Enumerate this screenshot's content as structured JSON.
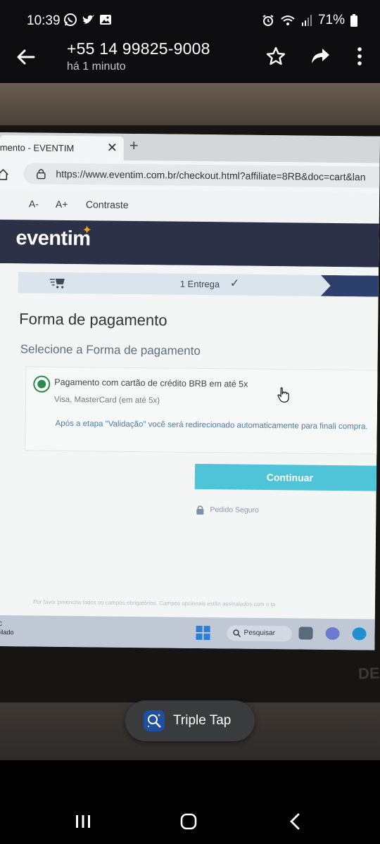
{
  "status_bar": {
    "time": "10:39",
    "battery": "71%",
    "notification_icons": [
      "whatsapp-icon",
      "twitter-icon",
      "gallery-icon"
    ],
    "system_icons": [
      "alarm-icon",
      "wifi-icon",
      "signal-icon",
      "battery-icon"
    ]
  },
  "header": {
    "title": "+55 14 99825-9008",
    "subtitle": "há 1 minuto"
  },
  "photo": {
    "browser": {
      "tab_title": "mento - EVENTIM",
      "tab_close": "✕",
      "new_tab": "+",
      "url": "https://www.eventim.com.br/checkout.html?affiliate=8RB&doc=cart&lan"
    },
    "accessibility_bar": {
      "decrease": "A-",
      "increase": "A+",
      "contrast": "Contraste"
    },
    "site": {
      "brand": "eventim",
      "brand_star": "✦",
      "step_label": "1  Entrega",
      "step_check": "✓",
      "heading": "Forma de pagamento",
      "subheading": "Selecione a Forma de pagamento",
      "option": {
        "title": "Pagamento com cartão de crédito BRB em até 5x",
        "subtitle": "Visa, MasterCard (em até 5x)",
        "note": "Após a etapa \"Validação\" você será redirecionado automaticamente para finali compra.",
        "selected": true
      },
      "continue_label": "Continuar",
      "secure_label": "Pedido Seguro",
      "footnote": "Por favor preencha todos os campos obrigatórios. Campos opcionais estão assinalados com o ta"
    },
    "taskbar": {
      "left_lines": [
        "PC",
        "ubilado"
      ],
      "search_label": "Pesquisar"
    },
    "laptop_brand": "DE"
  },
  "toast": {
    "label": "Triple Tap"
  },
  "colors": {
    "brand_bar": "#2d3148",
    "continue_button": "#4fc3d8",
    "radio_selected": "#2d8a4e",
    "brand_star": "#f0a520"
  }
}
